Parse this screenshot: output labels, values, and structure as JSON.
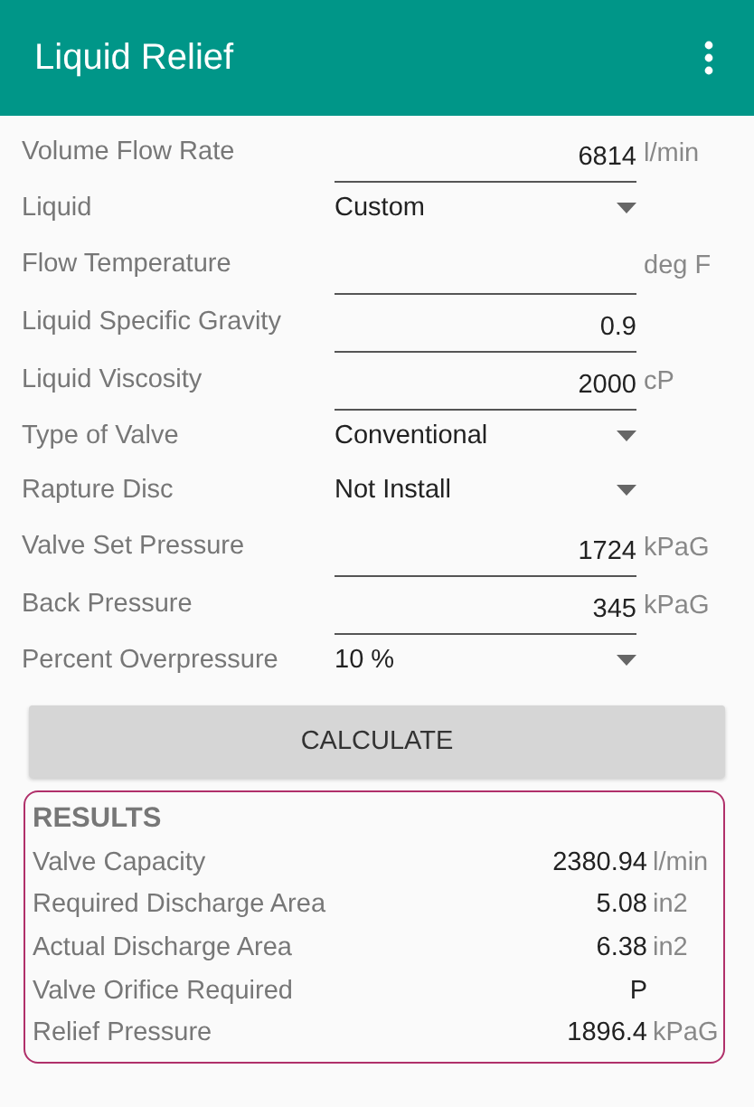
{
  "app_bar": {
    "title": "Liquid Relief"
  },
  "fields": [
    {
      "kind": "input",
      "label": "Volume Flow Rate",
      "value": "6814",
      "unit": "l/min"
    },
    {
      "kind": "dropdown",
      "label": "Liquid",
      "value": "Custom"
    },
    {
      "kind": "input",
      "label": "Flow Temperature",
      "unit": "deg F"
    },
    {
      "kind": "input",
      "label": "Liquid Specific Gravity",
      "value": "0.9"
    },
    {
      "kind": "input",
      "label": "Liquid Viscosity",
      "value": "2000",
      "unit": "cP"
    },
    {
      "kind": "dropdown",
      "label": "Type of Valve",
      "value": "Conventional"
    },
    {
      "kind": "dropdown",
      "label": "Rapture Disc",
      "value": "Not Install"
    },
    {
      "kind": "input",
      "label": "Valve Set Pressure",
      "value": "1724",
      "unit": "kPaG"
    },
    {
      "kind": "input",
      "label": "Back Pressure",
      "value": "345",
      "unit": "kPaG"
    },
    {
      "kind": "dropdown",
      "label": "Percent Overpressure",
      "value": "10 %"
    }
  ],
  "button": "CALCULATE",
  "results": {
    "title": "RESULTS",
    "rows": [
      {
        "label": "Valve Capacity",
        "value": "2380.94",
        "unit": "l/min"
      },
      {
        "label": "Required Discharge Area",
        "value": "5.08",
        "unit": "in2"
      },
      {
        "label": "Actual Discharge Area",
        "value": "6.38",
        "unit": "in2"
      },
      {
        "label": "Valve Orifice Required",
        "value": "P"
      },
      {
        "label": "Relief Pressure",
        "value": "1896.4",
        "unit": "kPaG"
      }
    ]
  }
}
